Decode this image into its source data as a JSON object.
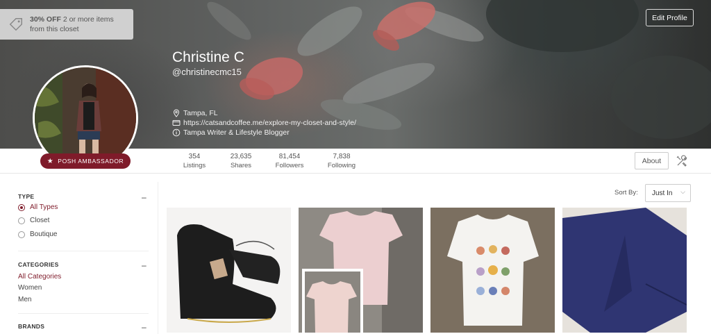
{
  "promo": {
    "bold": "30% OFF",
    "text": " 2 or more items",
    "text2": "from this closet"
  },
  "header": {
    "edit_profile": "Edit Profile",
    "name": "Christine C",
    "handle": "@christinecmc15",
    "location": "Tampa, FL",
    "website": "https://catsandcoffee.me/explore-my-closet-and-style/",
    "bio": "Tampa Writer & Lifestyle Blogger"
  },
  "badge": {
    "label": "POSH AMBASSADOR"
  },
  "stats": [
    {
      "value": "354",
      "label": "Listings"
    },
    {
      "value": "23,635",
      "label": "Shares"
    },
    {
      "value": "81,454",
      "label": "Followers"
    },
    {
      "value": "7,838",
      "label": "Following"
    }
  ],
  "about_button": "About",
  "sidebar": {
    "type": {
      "title": "TYPE",
      "options": [
        "All Types",
        "Closet",
        "Boutique"
      ],
      "selected": "All Types"
    },
    "categories": {
      "title": "CATEGORIES",
      "items": [
        "All Categories",
        "Women",
        "Men"
      ],
      "selected": "All Categories"
    },
    "brands": {
      "title": "BRANDS"
    },
    "collapse_symbol": "–"
  },
  "sort": {
    "label": "Sort By:",
    "value": "Just In"
  },
  "colors": {
    "accent": "#7f1b2a",
    "border": "#cccccc"
  },
  "icons": [
    "tag-icon",
    "location-pin-icon",
    "link-card-icon",
    "info-icon",
    "star-icon",
    "tools-icon",
    "chevron-down-icon",
    "minus-icon"
  ]
}
